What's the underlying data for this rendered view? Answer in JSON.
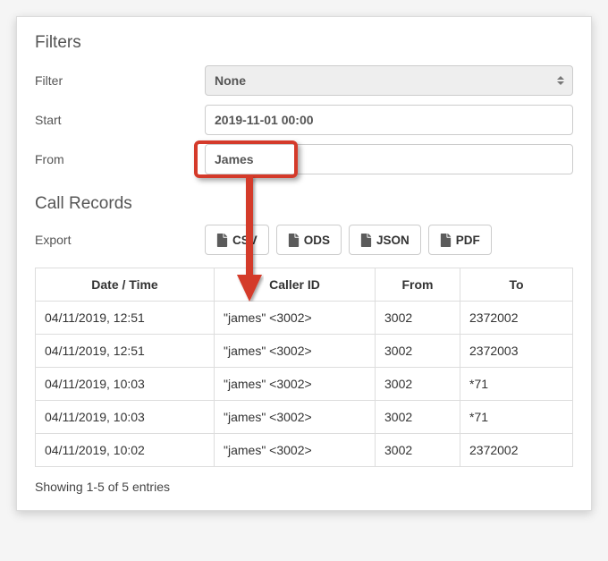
{
  "filters": {
    "heading": "Filters",
    "filter_label": "Filter",
    "filter_value": "None",
    "start_label": "Start",
    "start_value": "2019-11-01 00:00",
    "from_label": "From",
    "from_value": "James"
  },
  "records": {
    "heading": "Call Records",
    "export_label": "Export",
    "export_buttons": {
      "csv": "CSV",
      "ods": "ODS",
      "json": "JSON",
      "pdf": "PDF"
    },
    "columns": {
      "datetime": "Date / Time",
      "callerid": "Caller ID",
      "from": "From",
      "to": "To"
    },
    "rows": [
      {
        "datetime": "04/11/2019, 12:51",
        "callerid": "\"james\" <3002>",
        "from": "3002",
        "to": "2372002"
      },
      {
        "datetime": "04/11/2019, 12:51",
        "callerid": "\"james\" <3002>",
        "from": "3002",
        "to": "2372003"
      },
      {
        "datetime": "04/11/2019, 10:03",
        "callerid": "\"james\" <3002>",
        "from": "3002",
        "to": "*71"
      },
      {
        "datetime": "04/11/2019, 10:03",
        "callerid": "\"james\" <3002>",
        "from": "3002",
        "to": "*71"
      },
      {
        "datetime": "04/11/2019, 10:02",
        "callerid": "\"james\" <3002>",
        "from": "3002",
        "to": "2372002"
      }
    ],
    "entries_text": "Showing 1-5 of 5 entries"
  },
  "annotation": {
    "highlight_color": "#d43a2a"
  }
}
